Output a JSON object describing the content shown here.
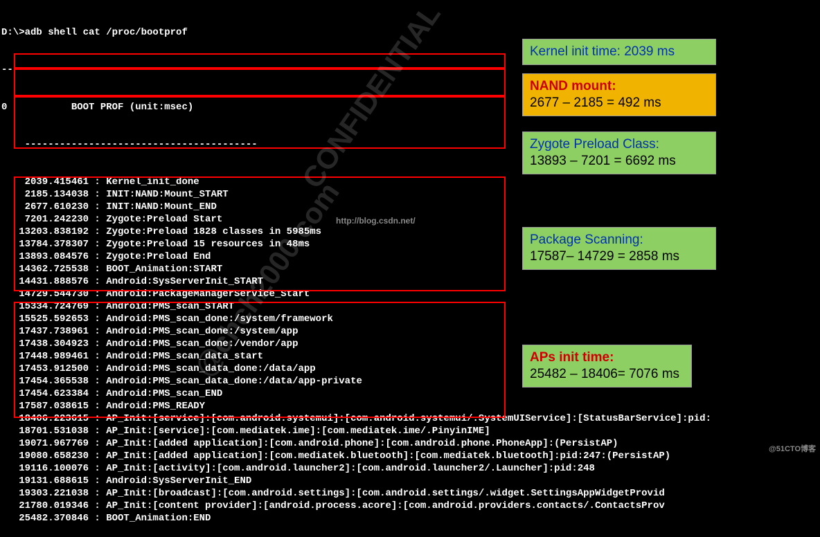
{
  "command": "D:\\>adb shell cat /proc/bootprof",
  "dashes1": "----------------------------------------",
  "header": "0           BOOT PROF (unit:msec)",
  "dashes2": "    ----------------------------------------",
  "lines": [
    {
      "t": "    2039.415461",
      "s": " : Kernel_init_done"
    },
    {
      "t": "    2185.134038",
      "s": " : INIT:NAND:Mount_START"
    },
    {
      "t": "    2677.610230",
      "s": " : INIT:NAND:Mount_END"
    },
    {
      "t": "    7201.242230",
      "s": " : Zygote:Preload Start"
    },
    {
      "t": "   13203.838192",
      "s": " : Zygote:Preload 1828 classes in 5985ms"
    },
    {
      "t": "   13784.378307",
      "s": " : Zygote:Preload 15 resources in 48ms"
    },
    {
      "t": "   13893.084576",
      "s": " : Zygote:Preload End"
    },
    {
      "t": "   14362.725538",
      "s": " : BOOT_Animation:START"
    },
    {
      "t": "   14431.888576",
      "s": " : Android:SysServerInit_START"
    },
    {
      "t": "   14729.544730",
      "s": " : Android:PackageManagerService_Start"
    },
    {
      "t": "   15334.724769",
      "s": " : Android:PMS_scan_START"
    },
    {
      "t": "   15525.592653",
      "s": " : Android:PMS_scan_done:/system/framework"
    },
    {
      "t": "   17437.738961",
      "s": " : Android:PMS_scan_done:/system/app"
    },
    {
      "t": "   17438.304923",
      "s": " : Android:PMS_scan_done:/vendor/app"
    },
    {
      "t": "   17448.989461",
      "s": " : Android:PMS_scan_data_start"
    },
    {
      "t": "   17453.912500",
      "s": " : Android:PMS_scan_data_done:/data/app"
    },
    {
      "t": "   17454.365538",
      "s": " : Android:PMS_scan_data_done:/data/app-private"
    },
    {
      "t": "   17454.623384",
      "s": " : Android:PMS_scan_END"
    },
    {
      "t": "   17587.038615",
      "s": " : Android:PMS_READY"
    },
    {
      "t": "   18406.223615",
      "s": " : AP_Init:[service]:[com.android.systemui]:[com.android.systemui/.SystemUIService]:[StatusBarService]:pid:"
    },
    {
      "t": "   18701.531038",
      "s": " : AP_Init:[service]:[com.mediatek.ime]:[com.mediatek.ime/.PinyinIME]"
    },
    {
      "t": "   19071.967769",
      "s": " : AP_Init:[added application]:[com.android.phone]:[com.android.phone.PhoneApp]:(PersistAP)"
    },
    {
      "t": "   19080.658230",
      "s": " : AP_Init:[added application]:[com.mediatek.bluetooth]:[com.mediatek.bluetooth]:pid:247:(PersistAP)"
    },
    {
      "t": "   19116.100076",
      "s": " : AP_Init:[activity]:[com.android.launcher2]:[com.android.launcher2/.Launcher]:pid:248"
    },
    {
      "t": "   19131.688615",
      "s": " : Android:SysServerInit_END"
    },
    {
      "t": "   19303.221038",
      "s": " : AP_Init:[broadcast]:[com.android.settings]:[com.android.settings/.widget.SettingsAppWidgetProvid"
    },
    {
      "t": "   21780.019346",
      "s": " : AP_Init:[content provider]:[android.process.acore]:[com.android.providers.contacts/.ContactsProv"
    },
    {
      "t": "   25482.370846",
      "s": " : BOOT_Animation:END"
    }
  ],
  "callouts": {
    "kernel": {
      "label": "Kernel init time: ",
      "value": "2039 ms"
    },
    "nand": {
      "label": "NAND mount:",
      "calc": "2677 – 2185 = 492 ms"
    },
    "zygote": {
      "label": "Zygote Preload Class:",
      "calc": "13893 – 7201 = 6692 ms"
    },
    "pkg": {
      "label": "Package Scanning:",
      "calc": "17587– 14729 = 2858 ms"
    },
    "aps": {
      "label": "APs init time:",
      "calc": "25482 – 18406= 7076 ms"
    }
  },
  "watermark": {
    "text1": "CONFIDENTIAL",
    "text2": "@chch2000.com",
    "url": "http://blog.csdn.net/",
    "footer": "@51CTO博客"
  }
}
